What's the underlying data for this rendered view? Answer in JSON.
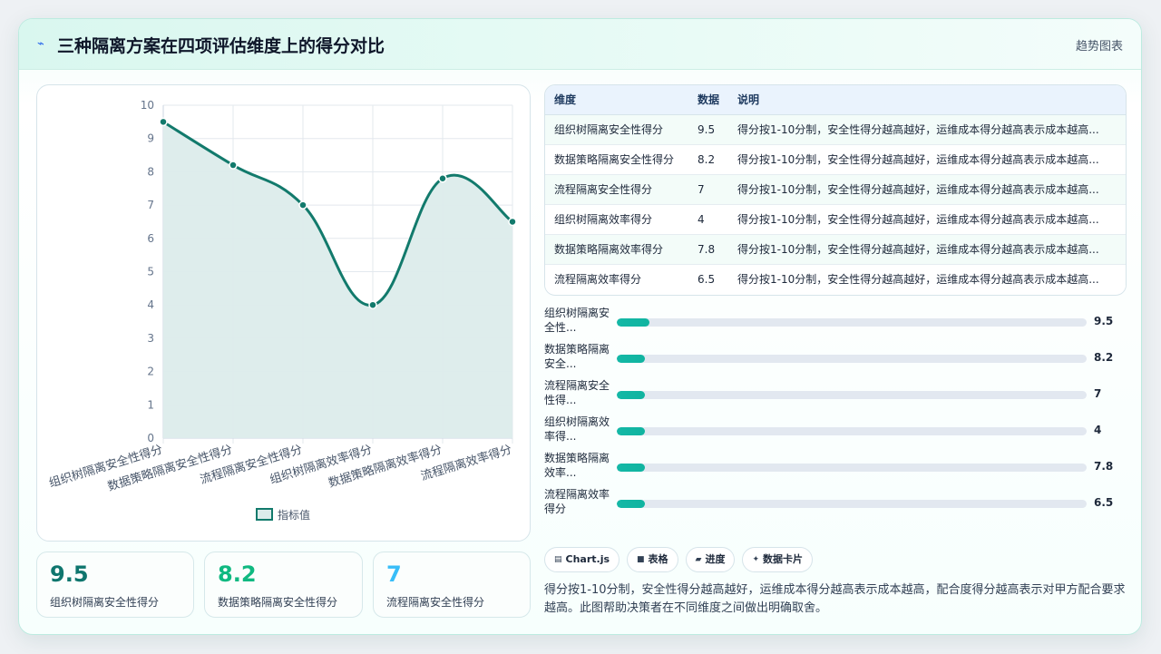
{
  "header": {
    "title": "三种隔离方案在四项评估维度上的得分对比",
    "tag": "趋势图表",
    "icon": "lightning-icon"
  },
  "chart_data": {
    "type": "line",
    "categories": [
      "组织树隔离安全性得分",
      "数据策略隔离安全性得分",
      "流程隔离安全性得分",
      "组织树隔离效率得分",
      "数据策略隔离效率得分",
      "流程隔离效率得分"
    ],
    "series": [
      {
        "name": "指标值",
        "values": [
          9.5,
          8.2,
          7,
          4,
          7.8,
          6.5
        ]
      }
    ],
    "yticks": [
      "0",
      "1",
      "2",
      "3",
      "4",
      "5",
      "6",
      "7",
      "8",
      "9",
      "10"
    ],
    "ylim": [
      0,
      10
    ],
    "grid": true,
    "legend": "bottom",
    "colors": {
      "line": "#127a6c",
      "fill": "#dceceb"
    }
  },
  "table": {
    "headers": [
      "维度",
      "数据",
      "说明"
    ],
    "rows": [
      [
        "组织树隔离安全性得分",
        "9.5",
        "得分按1-10分制，安全性得分越高越好，运维成本得分越高表示成本越高..."
      ],
      [
        "数据策略隔离安全性得分",
        "8.2",
        "得分按1-10分制，安全性得分越高越好，运维成本得分越高表示成本越高..."
      ],
      [
        "流程隔离安全性得分",
        "7",
        "得分按1-10分制，安全性得分越高越好，运维成本得分越高表示成本越高..."
      ],
      [
        "组织树隔离效率得分",
        "4",
        "得分按1-10分制，安全性得分越高越好，运维成本得分越高表示成本越高..."
      ],
      [
        "数据策略隔离效率得分",
        "7.8",
        "得分按1-10分制，安全性得分越高越好，运维成本得分越高表示成本越高..."
      ],
      [
        "流程隔离效率得分",
        "6.5",
        "得分按1-10分制，安全性得分越高越好，运维成本得分越高表示成本越高..."
      ]
    ]
  },
  "progress": [
    {
      "label": "组织树隔离安全性...",
      "value": "9.5",
      "fill": 0.07
    },
    {
      "label": "数据策略隔离安全...",
      "value": "8.2",
      "fill": 0.06
    },
    {
      "label": "流程隔离安全性得...",
      "value": "7",
      "fill": 0.06
    },
    {
      "label": "组织树隔离效率得...",
      "value": "4",
      "fill": 0.06
    },
    {
      "label": "数据策略隔离效率...",
      "value": "7.8",
      "fill": 0.06
    },
    {
      "label": "流程隔离效率得分",
      "value": "6.5",
      "fill": 0.06
    }
  ],
  "stats": [
    {
      "value": "9.5",
      "label": "组织树隔离安全性得分",
      "color": "#0f766e"
    },
    {
      "value": "8.2",
      "label": "数据策略隔离安全性得分",
      "color": "#10b981"
    },
    {
      "value": "7",
      "label": "流程隔离安全性得分",
      "color": "#38bdf8"
    }
  ],
  "chips": [
    {
      "icon": "chart-icon",
      "glyph": "▤",
      "label": "Chart.js"
    },
    {
      "icon": "table-icon",
      "glyph": "■",
      "label": "表格"
    },
    {
      "icon": "progress-icon",
      "glyph": "▰",
      "label": "进度"
    },
    {
      "icon": "sparkle-icon",
      "glyph": "✦",
      "label": "数据卡片"
    }
  ],
  "description": "得分按1-10分制，安全性得分越高越好，运维成本得分越高表示成本越高，配合度得分越高表示对甲方配合要求越高。此图帮助决策者在不同维度之间做出明确取舍。"
}
